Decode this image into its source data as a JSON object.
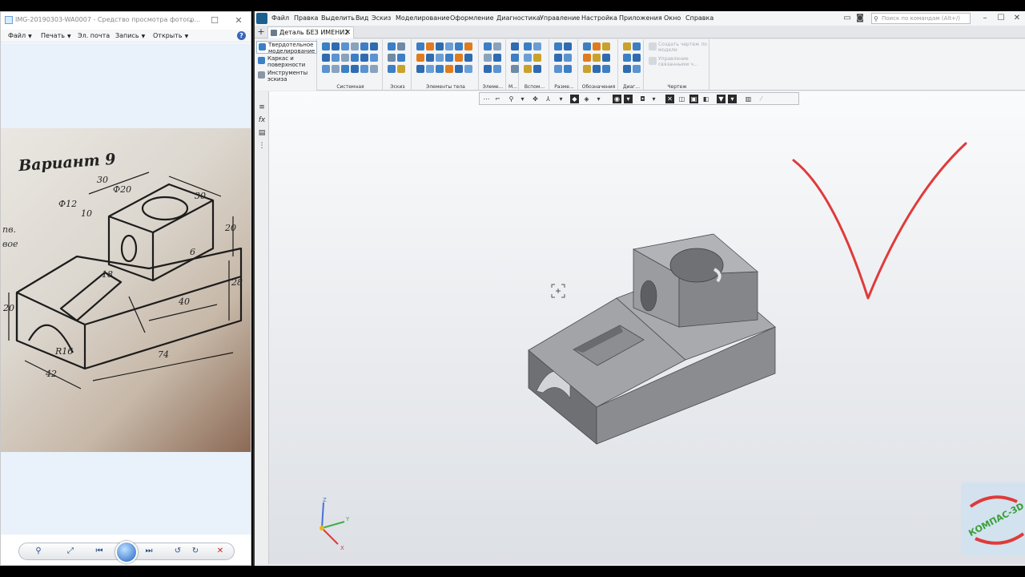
{
  "viewer": {
    "title": "IMG-20190303-WA0007 - Средство просмотра фотогр...",
    "menu": [
      {
        "label": "Файл",
        "dd": "▼"
      },
      {
        "label": "Печать",
        "dd": "▼"
      },
      {
        "label": "Эл. почта",
        "dd": ""
      },
      {
        "label": "Запись",
        "dd": "▼"
      },
      {
        "label": "Открыть",
        "dd": "▼"
      }
    ],
    "help_icon": "help-icon",
    "photo": {
      "heading": "Вариант 9",
      "side_text_1": "пв.",
      "side_text_2": "вое",
      "dims": [
        "30",
        "Ф20",
        "Ф12",
        "10",
        "30",
        "20",
        "6",
        "28",
        "40",
        "20",
        "R16",
        "74",
        "42",
        "18"
      ]
    },
    "navbar_icons": [
      "zoom-icon",
      "actual-size-icon",
      "previous-icon",
      "slideshow-icon",
      "next-icon",
      "rotate-left-icon",
      "rotate-right-icon",
      "delete-icon"
    ]
  },
  "kompas": {
    "menu": [
      "Файл",
      "Правка",
      "Выделить",
      "Вид",
      "Эскиз",
      "Моделирование",
      "Оформление",
      "Диагностика",
      "Управление",
      "Настройка",
      "Приложения",
      "Окно",
      "Справка"
    ],
    "search_placeholder": "Поиск по командам (Alt+/)",
    "doc_tab": "Деталь БЕЗ ИМЕНИ2",
    "modes": [
      "Твердотельное моделирование",
      "Каркас и поверхности",
      "Инструменты эскиза"
    ],
    "ribbon_groups": [
      "Системная",
      "Эскиз",
      "Элементы тела",
      "Элеме...",
      "М...",
      "Вспом...",
      "Разме...",
      "Обозначения",
      "Диаг...",
      "Чертеж"
    ],
    "drawing_cmds": [
      "Создать чертеж по модели",
      "Управление связанными ч..."
    ],
    "triad_labels": {
      "z": "Z",
      "y": "Y",
      "x": "X"
    },
    "watermark": "КОМПАС-3D",
    "colors": {
      "accent": "#3c7fc4",
      "check": "#e03a3a",
      "model_top": "#a9a9ab",
      "model_front": "#7d7d80",
      "model_side": "#8e8e91"
    }
  }
}
